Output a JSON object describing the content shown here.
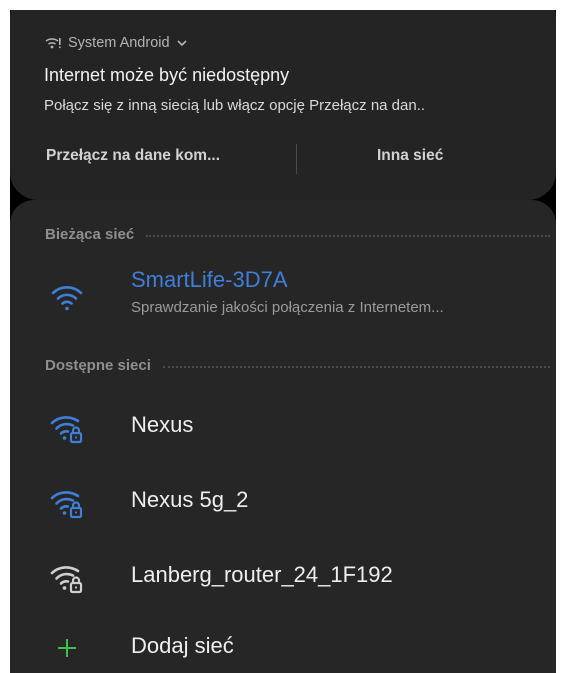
{
  "notification": {
    "app_name": "System Android",
    "title": "Internet może być niedostępny",
    "body": "Połącz się z inną siecią lub włącz opcję Przełącz na dan..",
    "actions": {
      "primary": "Przełącz na dane kom...",
      "secondary": "Inna sieć"
    }
  },
  "wifi": {
    "current_header": "Bieżąca sieć",
    "current": {
      "name": "SmartLife-3D7A",
      "status": "Sprawdzanie jakości połączenia z Internetem..."
    },
    "available_header": "Dostępne sieci",
    "networks": [
      {
        "name": "Nexus",
        "icon": "wifi-locked-icon",
        "color": "#3f7fd9"
      },
      {
        "name": "Nexus 5g_2",
        "icon": "wifi-locked-icon",
        "color": "#3f7fd9"
      },
      {
        "name": "Lanberg_router_24_1F192",
        "icon": "wifi-locked-icon",
        "color": "#cfcfcf"
      }
    ],
    "add_network": "Dodaj sieć"
  },
  "colors": {
    "accent": "#3f7fd9",
    "add": "#3fbf4f",
    "background": "#000000",
    "panel": "#262626"
  }
}
